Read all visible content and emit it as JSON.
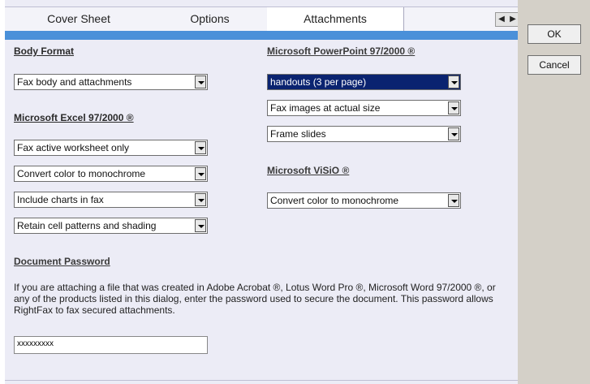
{
  "tabs": [
    "Cover Sheet",
    "Options",
    "Attachments"
  ],
  "body_format": {
    "heading": "Body Format",
    "value": "Fax body and attachments"
  },
  "excel": {
    "heading": "Microsoft Excel 97/2000 ®",
    "options": [
      "Fax active worksheet only",
      "Convert color to monochrome",
      "Include charts in fax",
      "Retain cell patterns and shading"
    ]
  },
  "powerpoint": {
    "heading": "Microsoft PowerPoint 97/2000 ®",
    "options": [
      "handouts (3 per page)",
      "Fax images at actual size",
      "Frame slides"
    ]
  },
  "visio": {
    "heading": "Microsoft ViSiO ®",
    "value": "Convert color to monochrome"
  },
  "password": {
    "heading": "Document Password",
    "description": "If you are attaching a file that was created in Adobe Acrobat ®, Lotus Word Pro ®, Microsoft Word 97/2000 ®, or any of the products listed in this dialog, enter the password used to secure the document. This password allows RightFax to fax secured attachments.",
    "value": "xxxxxxxxx"
  },
  "buttons": {
    "ok": "OK",
    "cancel": "Cancel"
  },
  "scroll_arrows": {
    "left": "◀",
    "right": "▶"
  }
}
